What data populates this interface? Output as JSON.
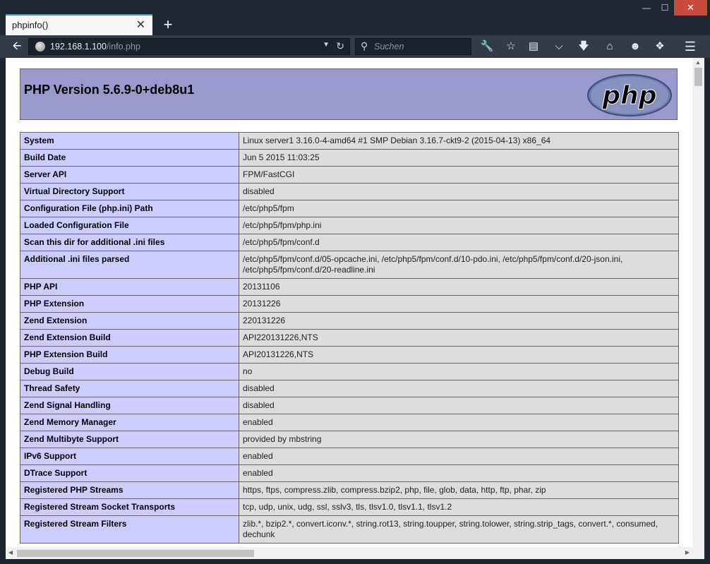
{
  "window": {
    "tab_title": "phpinfo()",
    "tab_close": "✕",
    "new_tab": "+",
    "min": "—",
    "max": "☐",
    "close": "✕"
  },
  "toolbar": {
    "url_host": "192.168.1.100",
    "url_path": "/info.php",
    "search_placeholder": "Suchen"
  },
  "page": {
    "heading": "PHP Version 5.6.9-0+deb8u1",
    "logo_text": "php",
    "rows": [
      {
        "key": "System",
        "value": "Linux server1 3.16.0-4-amd64 #1 SMP Debian 3.16.7-ckt9-2 (2015-04-13) x86_64"
      },
      {
        "key": "Build Date",
        "value": "Jun 5 2015 11:03:25"
      },
      {
        "key": "Server API",
        "value": "FPM/FastCGI"
      },
      {
        "key": "Virtual Directory Support",
        "value": "disabled"
      },
      {
        "key": "Configuration File (php.ini) Path",
        "value": "/etc/php5/fpm"
      },
      {
        "key": "Loaded Configuration File",
        "value": "/etc/php5/fpm/php.ini"
      },
      {
        "key": "Scan this dir for additional .ini files",
        "value": "/etc/php5/fpm/conf.d"
      },
      {
        "key": "Additional .ini files parsed",
        "value": "/etc/php5/fpm/conf.d/05-opcache.ini, /etc/php5/fpm/conf.d/10-pdo.ini, /etc/php5/fpm/conf.d/20-json.ini, /etc/php5/fpm/conf.d/20-readline.ini"
      },
      {
        "key": "PHP API",
        "value": "20131106"
      },
      {
        "key": "PHP Extension",
        "value": "20131226"
      },
      {
        "key": "Zend Extension",
        "value": "220131226"
      },
      {
        "key": "Zend Extension Build",
        "value": "API220131226,NTS"
      },
      {
        "key": "PHP Extension Build",
        "value": "API20131226,NTS"
      },
      {
        "key": "Debug Build",
        "value": "no"
      },
      {
        "key": "Thread Safety",
        "value": "disabled"
      },
      {
        "key": "Zend Signal Handling",
        "value": "disabled"
      },
      {
        "key": "Zend Memory Manager",
        "value": "enabled"
      },
      {
        "key": "Zend Multibyte Support",
        "value": "provided by mbstring"
      },
      {
        "key": "IPv6 Support",
        "value": "enabled"
      },
      {
        "key": "DTrace Support",
        "value": "enabled"
      },
      {
        "key": "Registered PHP Streams",
        "value": "https, ftps, compress.zlib, compress.bzip2, php, file, glob, data, http, ftp, phar, zip"
      },
      {
        "key": "Registered Stream Socket Transports",
        "value": "tcp, udp, unix, udg, ssl, sslv3, tls, tlsv1.0, tlsv1.1, tlsv1.2"
      },
      {
        "key": "Registered Stream Filters",
        "value": "zlib.*, bzip2.*, convert.iconv.*, string.rot13, string.toupper, string.tolower, string.strip_tags, convert.*, consumed, dechunk"
      }
    ]
  }
}
